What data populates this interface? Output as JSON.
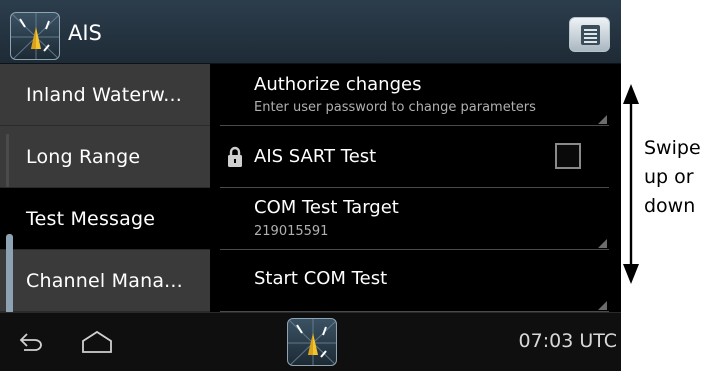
{
  "header": {
    "title": "AIS",
    "app_icon": "compass-icon",
    "menu_icon": "menu-list-icon"
  },
  "sidebar": {
    "items": [
      {
        "label": "Inland Waterw..."
      },
      {
        "label": "Long Range"
      },
      {
        "label": "Test Message",
        "active": true
      },
      {
        "label": "Channel Mana..."
      }
    ]
  },
  "settings": {
    "authorize": {
      "title": "Authorize changes",
      "subtitle": "Enter user password to change parameters"
    },
    "sart_test": {
      "title": "AIS SART Test",
      "checked": false,
      "icon": "lock-icon"
    },
    "com_target": {
      "title": "COM Test Target",
      "value": "219015591"
    },
    "start_com": {
      "title": "Start COM Test"
    }
  },
  "navbar": {
    "back_icon": "back-icon",
    "home_icon": "home-icon",
    "time": "07:03 UTC"
  },
  "annotation": {
    "lines": [
      "Swipe",
      "up or",
      "down"
    ]
  },
  "colors": {
    "titlebar": "#2c3d4c",
    "sidebar": "#3a3a3a",
    "background": "#000000",
    "accent": "#8da2b2"
  }
}
